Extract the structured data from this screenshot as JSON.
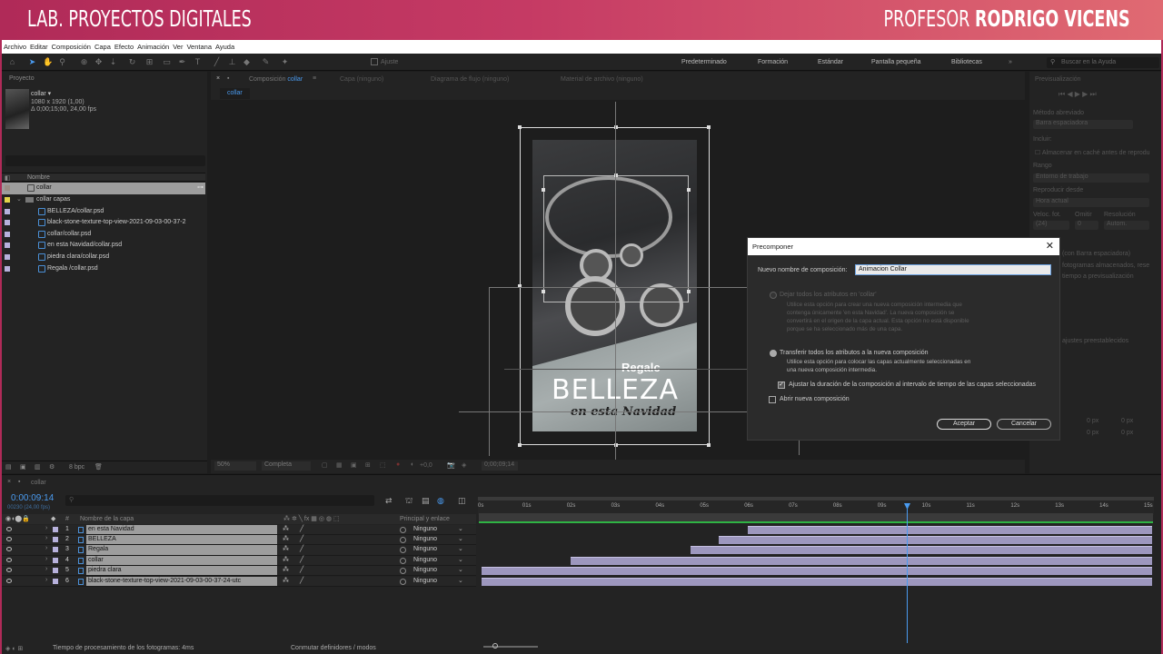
{
  "banner": {
    "left": "LAB. PROYECTOS DIGITALES",
    "right_prefix": "PROFESOR",
    "right_name": "RODRIGO VICENS"
  },
  "menu": [
    "Archivo",
    "Editar",
    "Composición",
    "Capa",
    "Efecto",
    "Animación",
    "Ver",
    "Ventana",
    "Ayuda"
  ],
  "toolbar": {
    "snap_label": "Ajuste",
    "workspaces": [
      "Predeterminado",
      "Formación",
      "Estándar",
      "Pantalla pequeña",
      "Bibliotecas"
    ],
    "search_placeholder": "Buscar en la Ayuda"
  },
  "project": {
    "tab": "Proyecto",
    "item_name": "collar",
    "item_info1": "1080 x 1920 (1,00)",
    "item_info2": "Δ 0;00;15;00, 24,00 fps",
    "col_name": "Nombre",
    "bpc": "8 bpc",
    "rows": [
      {
        "name": "collar",
        "swatch": "#9a8f86"
      },
      {
        "name": "collar capas",
        "swatch": "#e2d44a"
      },
      {
        "name": "BELLEZA/collar.psd",
        "swatch": "#b7b1dc"
      },
      {
        "name": "black-stone-texture-top-view-2021-09-03-00-37-2",
        "swatch": "#b7b1dc"
      },
      {
        "name": "collar/collar.psd",
        "swatch": "#b7b1dc"
      },
      {
        "name": "en esta Navidad/collar.psd",
        "swatch": "#b7b1dc"
      },
      {
        "name": "piedra clara/collar.psd",
        "swatch": "#b7b1dc"
      },
      {
        "name": "Regala /collar.psd",
        "swatch": "#b7b1dc"
      }
    ]
  },
  "comp": {
    "tab_prefix": "Composición",
    "tab_name": "collar",
    "tab_layer": "Capa (ninguno)",
    "tab_flow": "Diagrama de flujo (ninguno)",
    "tab_footage": "Material de archivo (ninguno)",
    "sub_tab": "collar",
    "zoom": "50%",
    "res": "Completa",
    "exposure": "+0,0",
    "time": "0;00;09;14"
  },
  "poster": {
    "brand": "Regalc",
    "title": "BELLEZA",
    "subtitle": "en esta Navidad"
  },
  "right_panel": {
    "title": "Previsualización",
    "shortcut_label": "Método abreviado",
    "shortcut_value": "Barra espaciadora",
    "include": "Incluir:",
    "cache": "Almacenar en caché antes de reprodu",
    "range": "Rango",
    "range_value": "Entorno de trabajo",
    "play_from": "Reproducir desde",
    "play_from_value": "Hora actual",
    "fps": "Veloc. fot.",
    "skip": "Omitir",
    "resolution": "Resolución",
    "fps_value": "(24)",
    "skip_value": "0",
    "res_value": "Autom.",
    "l1": "(con Barra espaciadora)",
    "l2": "fotogramas almacenados, rese",
    "l3": "tiempo a previsualización",
    "presets": "ajustes preestablecidos",
    "px1": "0 px",
    "px2": "0 px",
    "px3": "0 px",
    "px4": "0 px"
  },
  "dialog": {
    "title": "Precomponer",
    "name_label": "Nuevo nombre de composición:",
    "name_value": "Animacion Collar",
    "opt1_title": "Dejar todos los atributos en 'collar'",
    "opt1_l1": "Utilice esta opción para crear una nueva composición intermedia que",
    "opt1_l2": "contenga únicamente 'en esta Navidad'. La nueva composición se",
    "opt1_l3": "convertirá en el origen de la capa actual. Esta opción no está disponible",
    "opt1_l4": "porque se ha seleccionado más de una capa.",
    "opt2_title": "Transferir todos los atributos a la nueva composición",
    "opt2_l1": "Utilice esta opción para colocar las capas actualmente seleccionadas en",
    "opt2_l2": "una nueva composición intermedia.",
    "adjust_label": "Ajustar la duración de la composición al intervalo de tiempo de las capas seleccionadas",
    "open_label": "Abrir nueva composición",
    "ok": "Aceptar",
    "cancel": "Cancelar"
  },
  "timeline": {
    "tab": "collar",
    "timecode": "0:00:09:14",
    "frames": "00230 (24,00 fps)",
    "col_layer": "Nombre de la capa",
    "col_parent": "Principal y enlace",
    "ticks": [
      "0s",
      "01s",
      "02s",
      "03s",
      "04s",
      "05s",
      "06s",
      "07s",
      "08s",
      "09s",
      "10s",
      "11s",
      "12s",
      "13s",
      "14s",
      "15s"
    ],
    "layers": [
      {
        "num": "1",
        "name": "en esta Navidad",
        "parent": "Ninguno",
        "start": 6.0
      },
      {
        "num": "2",
        "name": "BELLEZA",
        "parent": "Ninguno",
        "start": 5.35
      },
      {
        "num": "3",
        "name": "Regala",
        "parent": "Ninguno",
        "start": 4.7
      },
      {
        "num": "4",
        "name": "collar",
        "parent": "Ninguno",
        "start": 2.0
      },
      {
        "num": "5",
        "name": "piedra clara",
        "parent": "Ninguno",
        "start": 0.0
      },
      {
        "num": "6",
        "name": "black-stone-texture-top-view-2021-09-03-00-37-24-utc",
        "parent": "Ninguno",
        "start": 0.0
      }
    ],
    "current_time_s": 9.58
  },
  "status": {
    "render_prefix": "Tiempo de procesamiento de los fotogramas:",
    "render_value": "4ms",
    "toggle": "Conmutar definidores / modos"
  },
  "colors": {
    "accent": "#4a9bf0",
    "banner_start": "#b02a58",
    "banner_end": "#e06a72",
    "layer_bar": "#9d97be"
  }
}
